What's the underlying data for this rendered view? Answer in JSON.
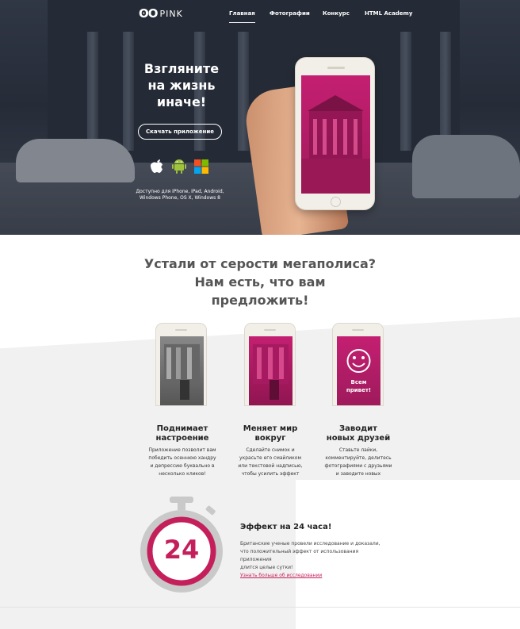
{
  "brand": {
    "logo_mark": "ʘO",
    "logo_text": "PINK"
  },
  "nav": {
    "items": [
      {
        "label": "Главная",
        "active": true
      },
      {
        "label": "Фотографии",
        "active": false
      },
      {
        "label": "Конкурс",
        "active": false
      },
      {
        "label": "HTML Academy",
        "active": false
      }
    ]
  },
  "hero": {
    "title_line1": "Взгляните",
    "title_line2": "на жизнь",
    "title_line3": "иначе!",
    "download_label": "Скачать приложение",
    "platform_icons": [
      "apple-icon",
      "android-icon",
      "windows-icon"
    ],
    "available_line1": "Доступно для iPhone, iPad, Android,",
    "available_line2": "Windows Phone, OS X, Windows 8"
  },
  "intro": {
    "line1": "Устали от серости мегаполиса?",
    "line2": "Нам есть, что вам",
    "line3": "предложить!"
  },
  "features": [
    {
      "title_line1": "Поднимает",
      "title_line2": "настроение",
      "text": [
        "Приложение позволит вам",
        "победить осеннюю хандру",
        "и депрессию буквально в",
        "несколько кликов!"
      ]
    },
    {
      "title_line1": "Меняет мир",
      "title_line2": "вокруг",
      "text": [
        "Сделайте снимок и",
        "украсьте его смайликом",
        "или текстовой надписью,",
        "чтобы усилить эффект"
      ]
    },
    {
      "title_line1": "Заводит",
      "title_line2": "новых друзей",
      "text": [
        "Ставьте лайки,",
        "комментируйте, делитесь",
        "фотографиями с друзьями",
        "и заводите новых"
      ]
    }
  ],
  "phone3_caption": {
    "line1": "Всем",
    "line2": "привет!"
  },
  "effect": {
    "number": "24",
    "title": "Эффект на 24 часа!",
    "text": [
      "Британские ученые провели исследование и доказали,",
      "что положительный эффект от использования приложения",
      "длится целые сутки!"
    ],
    "link": "Узнать больше об исследовании"
  },
  "colors": {
    "accent": "#c41f5b",
    "magenta": "#c41f71",
    "hero_dark": "#2b313c",
    "band": "#f1f1f1"
  }
}
